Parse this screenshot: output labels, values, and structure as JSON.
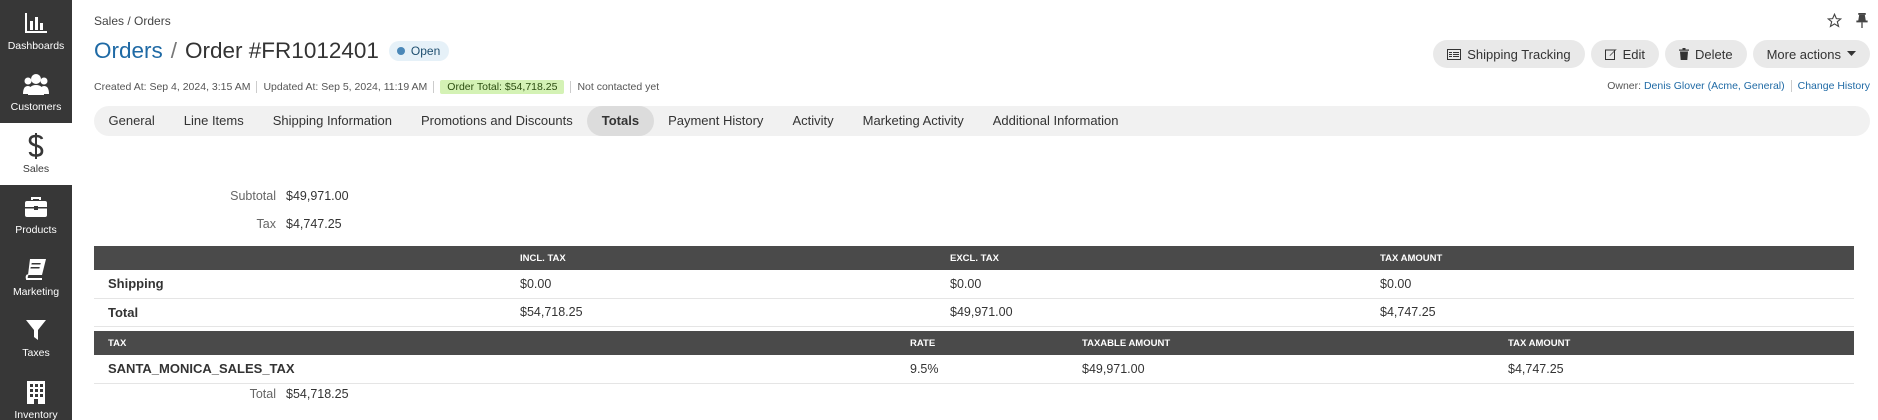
{
  "sidebar": {
    "items": [
      {
        "label": "Dashboards",
        "icon": "bar-chart-icon"
      },
      {
        "label": "Customers",
        "icon": "users-icon"
      },
      {
        "label": "Sales",
        "icon": "dollar-icon",
        "active": true
      },
      {
        "label": "Products",
        "icon": "briefcase-icon"
      },
      {
        "label": "Marketing",
        "icon": "book-icon"
      },
      {
        "label": "Taxes",
        "icon": "filter-icon"
      },
      {
        "label": "Inventory",
        "icon": "building-icon"
      }
    ]
  },
  "header": {
    "breadcrumb": "Sales / Orders",
    "title_link": "Orders",
    "title_sep": "/",
    "title": "Order #FR1012401",
    "status": "Open"
  },
  "actions": {
    "shipping_tracking": "Shipping Tracking",
    "edit": "Edit",
    "delete": "Delete",
    "more": "More actions"
  },
  "meta": {
    "created": "Created At: Sep 4, 2024, 3:15 AM",
    "updated": "Updated At: Sep 5, 2024, 11:19 AM",
    "order_total": "Order Total: $54,718.25",
    "contact": "Not contacted yet",
    "owner_label": "Owner:",
    "owner_name": "Denis Glover",
    "owner_org": "(Acme, General)",
    "change_history": "Change History"
  },
  "tabs": [
    {
      "label": "General"
    },
    {
      "label": "Line Items"
    },
    {
      "label": "Shipping Information"
    },
    {
      "label": "Promotions and Discounts"
    },
    {
      "label": "Totals",
      "active": true
    },
    {
      "label": "Payment History"
    },
    {
      "label": "Activity"
    },
    {
      "label": "Marketing Activity"
    },
    {
      "label": "Additional Information"
    }
  ],
  "totals": {
    "subtotal_label": "Subtotal",
    "subtotal_value": "$49,971.00",
    "tax_label": "Tax",
    "tax_value": "$4,747.25",
    "total_label": "Total",
    "total_value": "$54,718.25"
  },
  "shipping_table": {
    "headers": [
      "",
      "INCL. TAX",
      "EXCL. TAX",
      "TAX AMOUNT"
    ],
    "rows": [
      [
        "Shipping",
        "$0.00",
        "$0.00",
        "$0.00"
      ],
      [
        "Total",
        "$54,718.25",
        "$49,971.00",
        "$4,747.25"
      ]
    ]
  },
  "tax_table": {
    "headers": [
      "TAX",
      "RATE",
      "TAXABLE AMOUNT",
      "TAX AMOUNT"
    ],
    "rows": [
      [
        "SANTA_MONICA_SALES_TAX",
        "9.5%",
        "$49,971.00",
        "$4,747.25"
      ]
    ]
  }
}
